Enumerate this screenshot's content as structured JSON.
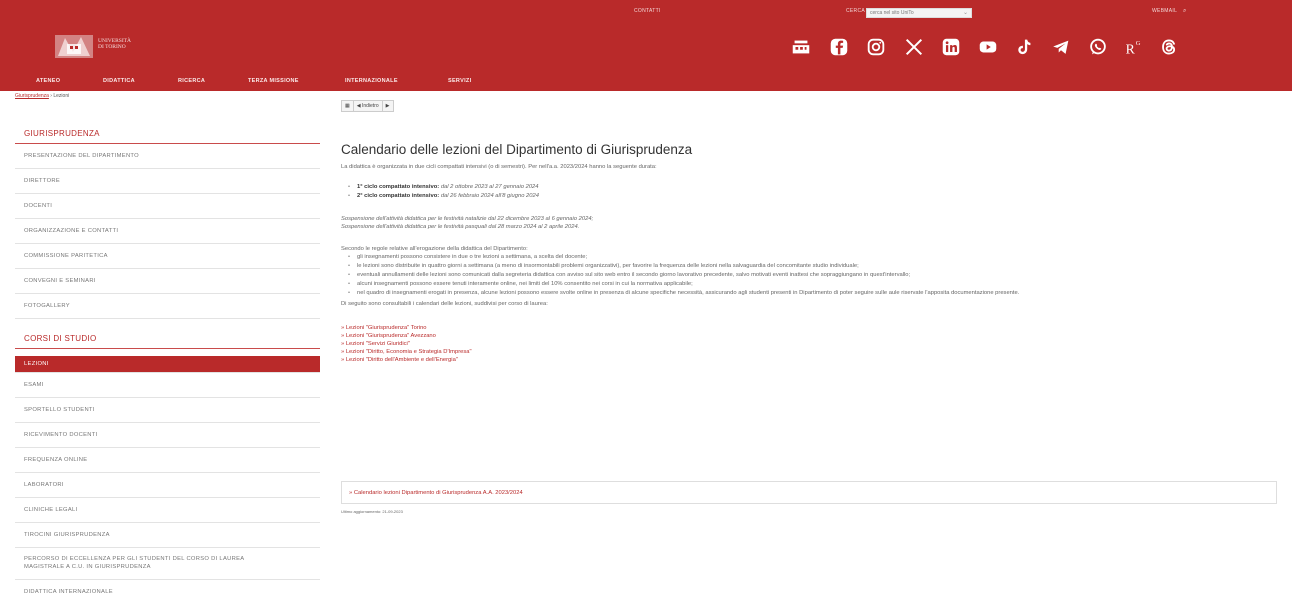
{
  "header": {
    "util_contacts": "CONTATTI",
    "util_search_label": "CERCA",
    "search_placeholder": "cerca nel sito UniTo",
    "util_webmail": "WEBMAIL",
    "logo_text_line1": "UNIVERSITÀ",
    "logo_text_line2": "DI TORINO",
    "menu": [
      "ATENEO",
      "DIDATTICA",
      "RICERCA",
      "TERZA MISSIONE",
      "INTERNAZIONALE",
      "SERVIZI"
    ],
    "social_icons": [
      "pigeonhole-icon",
      "facebook-icon",
      "instagram-icon",
      "x-icon",
      "linkedin-icon",
      "youtube-icon",
      "tiktok-icon",
      "telegram-icon",
      "whatsapp-icon",
      "researchgate-icon",
      "threads-icon"
    ],
    "brand_color": "#b92a2a"
  },
  "breadcrumb": {
    "home": "Giurisprudenza",
    "separator": " › ",
    "current": "Lezioni"
  },
  "sidebar": {
    "section1_title": "GIURISPRUDENZA",
    "section1_items": [
      "PRESENTAZIONE DEL DIPARTIMENTO",
      "DIRETTORE",
      "DOCENTI",
      "ORGANIZZAZIONE E CONTATTI",
      "COMMISSIONE PARITETICA",
      "CONVEGNI E SEMINARI",
      "FOTOGALLERY"
    ],
    "section2_title": "CORSI DI STUDIO",
    "section2_items": [
      "LEZIONI",
      "ESAMI",
      "SPORTELLO STUDENTI",
      "RICEVIMENTO DOCENTI",
      "FREQUENZA ONLINE",
      "LABORATORI",
      "CLINICHE LEGALI",
      "TIROCINI GIURISPRUDENZA",
      "PERCORSO DI ECCELLENZA PER GLI STUDENTI DEL CORSO DI LAUREA MAGISTRALE A C.U. IN GIURISPRUDENZA",
      "DIDATTICA INTERNAZIONALE"
    ]
  },
  "toolbar": {
    "grid_label": "▦",
    "back_label": "◀ Indietro",
    "next_label": "▶"
  },
  "main": {
    "title": "Calendario delle lezioni del Dipartimento di Giurisprudenza",
    "intro": "La didattica è organizzata in due cicli compattati intensivi (o di semestri). Per nell'a.a. 2023/2024 hanno la seguente durata:",
    "cycles": [
      {
        "label": "1° ciclo compattato intensivo:",
        "dates": "dal 2 ottobre 2023 al 27 gennaio 2024"
      },
      {
        "label": "2° ciclo compattato intensivo:",
        "dates": "dal 26 febbraio 2024 all'8 giugno 2024"
      }
    ],
    "suspension1": "Sospensione dell'attività didattica per le festività natalizie dal 22 dicembre 2023 al 6 gennaio 2024;",
    "suspension2": "Sospensione dell'attività didattica per le festività pasquali dal 28 marzo 2024 al 2 aprile 2024.",
    "rules_intro": "Secondo le regole relative all'erogazione della didattica del Dipartimento:",
    "rules": [
      "gli insegnamenti possono consistere in due o tre lezioni a settimana, a scelta del docente;",
      "le lezioni sono distribuite in quattro giorni a settimana (a meno di insormontabili problemi organizzativi), per favorire la frequenza delle lezioni nella salvaguardia del concomitante studio individuale;",
      "eventuali annullamenti delle lezioni sono comunicati dalla segreteria didattica con avviso sul sito web entro il secondo giorno lavorativo precedente, salvo motivati eventi inattesi che sopraggiungano in quest'intervallo;",
      "alcuni insegnamenti possono essere tenuti interamente online, nei limiti del 10% consentito nei corsi in cui la normativa applicabile;",
      "nel quadro di insegnamenti erogati in presenza, alcune lezioni possono essere svolte online in presenza di alcune specifiche necessità, assicurando agli studenti presenti in Dipartimento di poter seguire sulle aule riservate l'apposita documentazione presente."
    ],
    "list_intro": "Di seguito sono consultabili i calendari delle lezioni, suddivisi per corso di laurea:",
    "links": [
      "» Lezioni \"Giurisprudenza\" Torino",
      "» Lezioni \"Giurisprudenza\" Avezzano",
      "» Lezioni \"Servizi Giuridici\"",
      "» Lezioni \"Diritto, Economia e Strategia D'Impresa\"",
      "» Lezioni \"Diritto dell'Ambiente e dell'Energia\""
    ],
    "box_link": "» Calendario lezioni Dipartimento di Giurisprudenza A.A. 2023/2024",
    "updated": "Ultimo aggiornamento: 21-09-2023"
  }
}
